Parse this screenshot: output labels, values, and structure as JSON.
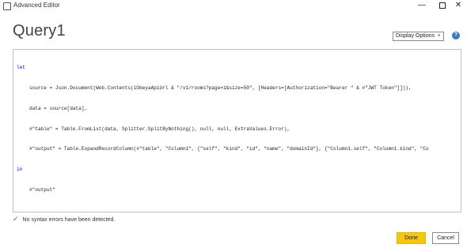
{
  "window": {
    "title": "Advanced Editor",
    "minimize_label": "—",
    "close_label": "✕"
  },
  "query": {
    "title": "Query1"
  },
  "toolbar": {
    "display_options_label": "Display Options",
    "display_options_chevron": "˅",
    "help_label": "?"
  },
  "code": {
    "line1": "let",
    "line2": "source = Json.Document(Web.Contents(iObeyaApiUrl & \"/v1/rooms?page=1&size=50\", [Headers=[Authorization=\"Bearer \" & #\"JWT Token\"]])),",
    "line3": "data = source[data],",
    "line4": "#\"table\" = Table.FromList(data, Splitter.SplitByNothing(), null, null, ExtraValues.Error),",
    "line5": "#\"output\" = Table.ExpandRecordColumn(#\"table\", \"Column1\", {\"self\", \"kind\", \"id\", \"name\", \"domainId\"}, {\"Column1.self\", \"Column1.kind\", \"Co",
    "line6": "in",
    "line7": "#\"output\""
  },
  "status": {
    "icon": "checkmark-icon",
    "text": "No syntax errors have been detected."
  },
  "buttons": {
    "done_label": "Done",
    "cancel_label": "Cancel"
  },
  "colors": {
    "accent_done": "#f2c811",
    "help_blue": "#3b79c3",
    "keyword": "#0000ff",
    "success": "#2e8b2e"
  }
}
